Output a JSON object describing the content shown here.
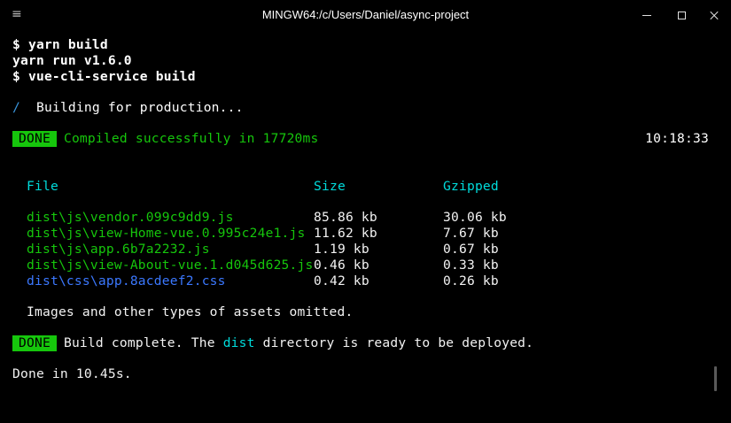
{
  "window": {
    "title": "MINGW64:/c/Users/Daniel/async-project",
    "menu_icon": "≡"
  },
  "terminal": {
    "l1": "$ yarn build",
    "l2": "yarn run v1.6.0",
    "l3": "$ vue-cli-service build",
    "spinner": "/",
    "building": "Building for production...",
    "done_badge": "DONE",
    "compiled": "Compiled successfully in 17720ms",
    "time": "10:18:33",
    "table": {
      "headers": [
        "File",
        "Size",
        "Gzipped"
      ],
      "rows": [
        {
          "file": "dist\\js\\vendor.099c9dd9.js",
          "size": "85.86 kb",
          "gzip": "30.06 kb",
          "color": "green"
        },
        {
          "file": "dist\\js\\view-Home-vue.0.995c24e1.js",
          "size": "11.62 kb",
          "gzip": "7.67 kb",
          "color": "green"
        },
        {
          "file": "dist\\js\\app.6b7a2232.js",
          "size": "1.19 kb",
          "gzip": "0.67 kb",
          "color": "green"
        },
        {
          "file": "dist\\js\\view-About-vue.1.d045d625.js",
          "size": "0.46 kb",
          "gzip": "0.33 kb",
          "color": "green"
        },
        {
          "file": "dist\\css\\app.8acdeef2.css",
          "size": "0.42 kb",
          "gzip": "0.26 kb",
          "color": "blue"
        }
      ]
    },
    "omitted": "Images and other types of assets omitted.",
    "done_badge2": "DONE",
    "complete_pre": "Build complete. The ",
    "complete_dir": "dist",
    "complete_post": " directory is ready to be deployed.",
    "finished": "Done in 10.45s."
  },
  "colors": {
    "background": "#000000",
    "green": "#16c60c",
    "cyan": "#00dcdc",
    "blue": "#3b78ff"
  }
}
